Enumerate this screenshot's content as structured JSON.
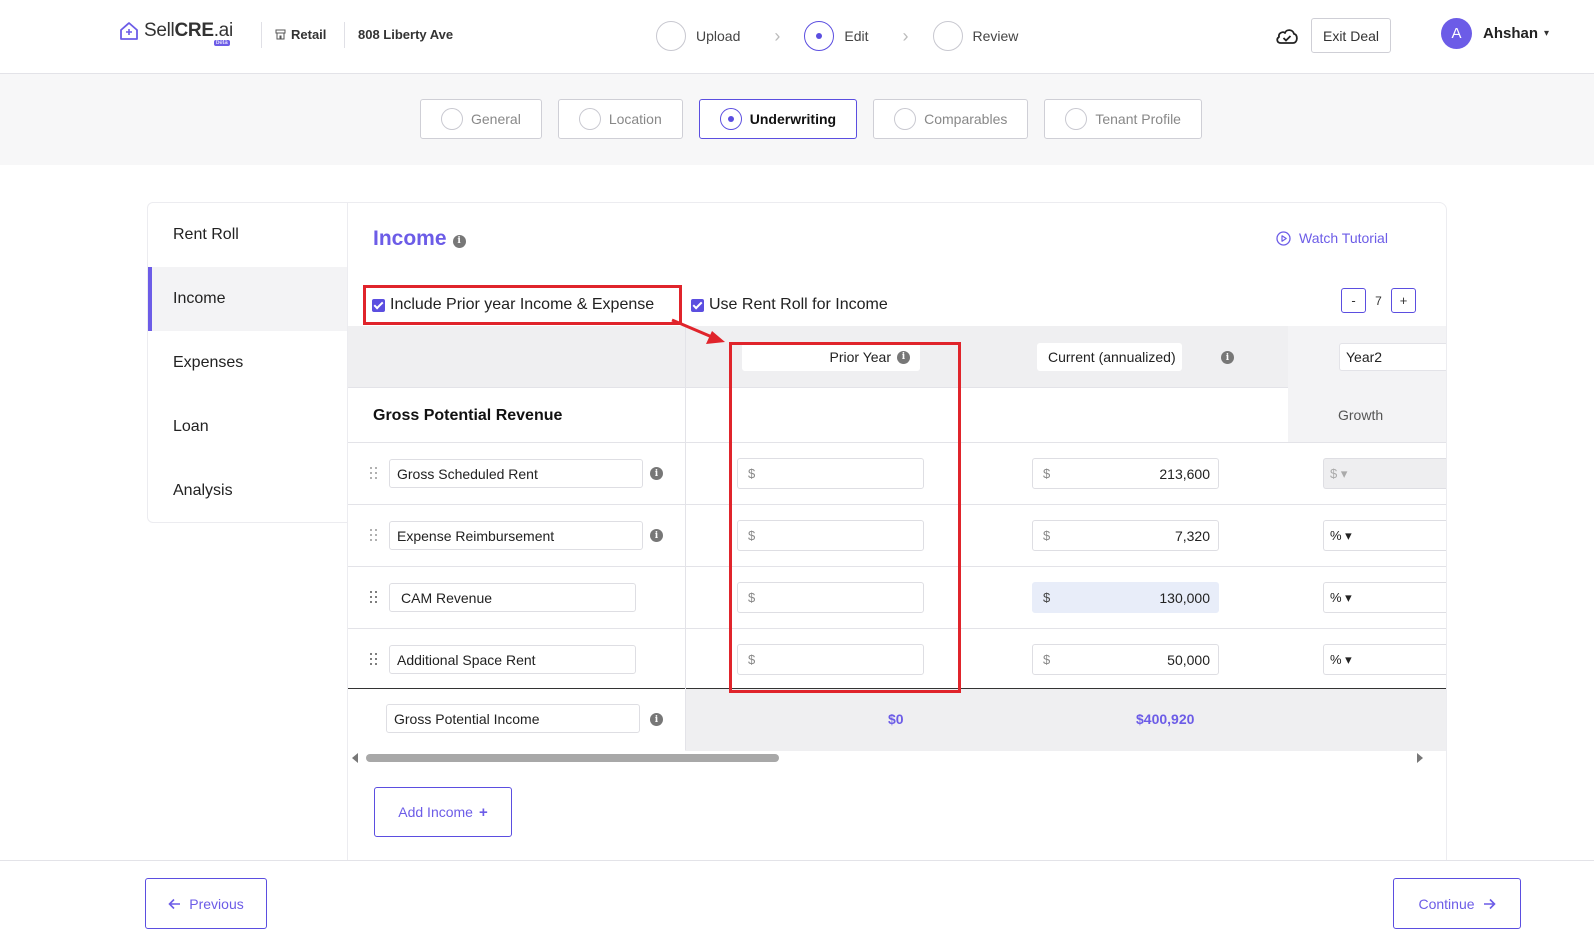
{
  "header": {
    "logo_text_pre": "Sell",
    "logo_text_bold": "CRE",
    "logo_text_post": ".ai",
    "beta_label": "beta",
    "property_type": "Retail",
    "address": "808 Liberty Ave",
    "steps": [
      {
        "label": "Upload",
        "state": "inactive"
      },
      {
        "label": "Edit",
        "state": "active"
      },
      {
        "label": "Review",
        "state": "inactive"
      }
    ],
    "exit_label": "Exit Deal",
    "user_initial": "A",
    "user_name": "Ahshan"
  },
  "tabs": [
    {
      "label": "General",
      "active": false
    },
    {
      "label": "Location",
      "active": false
    },
    {
      "label": "Underwriting",
      "active": true
    },
    {
      "label": "Comparables",
      "active": false
    },
    {
      "label": "Tenant Profile",
      "active": false
    }
  ],
  "sidebar": {
    "items": [
      {
        "label": "Rent Roll",
        "active": false
      },
      {
        "label": "Income",
        "active": true
      },
      {
        "label": "Expenses",
        "active": false
      },
      {
        "label": "Loan",
        "active": false
      },
      {
        "label": "Analysis",
        "active": false
      }
    ]
  },
  "income": {
    "title": "Income",
    "tutorial_label": "Watch Tutorial",
    "checkbox_prior": "Include Prior year Income & Expense",
    "checkbox_rentroll": "Use Rent Roll for Income",
    "years_minus": "-",
    "years_value": "7",
    "years_plus": "+",
    "columns": {
      "prior": "Prior Year",
      "current": "Current (annualized)",
      "year2": "Year2"
    },
    "section_title": "Gross Potential Revenue",
    "growth_label": "Growth",
    "currency": "$",
    "rows": [
      {
        "name": "Gross Scheduled Rent",
        "prior": "",
        "current": "213,600",
        "growth": "$ ▾"
      },
      {
        "name": "Expense Reimbursement",
        "prior": "",
        "current": "7,320",
        "growth": "% ▾"
      },
      {
        "name": "CAM Revenue",
        "prior": "",
        "current": "130,000",
        "growth": "% ▾"
      },
      {
        "name": "Additional Space Rent",
        "prior": "",
        "current": "50,000",
        "growth": "% ▾"
      }
    ],
    "total": {
      "name": "Gross Potential Income",
      "prior": "$0",
      "current": "$400,920"
    },
    "add_label": "Add Income",
    "add_plus": "+"
  },
  "footer": {
    "previous_label": "Previous",
    "continue_label": "Continue"
  },
  "colors": {
    "accent": "#6c5ce7",
    "annotation_red": "#e0242b"
  }
}
